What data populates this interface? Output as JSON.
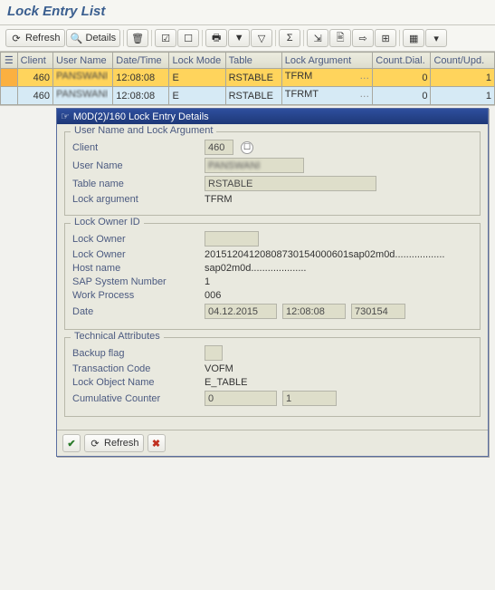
{
  "page_title": "Lock Entry List",
  "toolbar": {
    "refresh_label": "Refresh",
    "details_label": "Details"
  },
  "grid": {
    "headers": {
      "client": "Client",
      "user": "User Name",
      "datetime": "Date/Time",
      "mode": "Lock Mode",
      "table": "Table",
      "arg": "Lock Argument",
      "dial": "Count.Dial.",
      "upd": "Count/Upd."
    },
    "rows": [
      {
        "client": "460",
        "user": "PANSWANI",
        "datetime": "12:08:08",
        "mode": "E",
        "table": "RSTABLE",
        "arg": "TFRM",
        "dial": "0",
        "upd": "1"
      },
      {
        "client": "460",
        "user": "PANSWANI",
        "datetime": "12:08:08",
        "mode": "E",
        "table": "RSTABLE",
        "arg": "TFRMT",
        "dial": "0",
        "upd": "1"
      }
    ]
  },
  "dialog": {
    "title": "M0D(2)/160 Lock Entry Details",
    "g1": {
      "legend": "User Name and Lock Argument",
      "client_label": "Client",
      "client_value": "460",
      "user_label": "User Name",
      "user_value": "PANSWANI",
      "table_label": "Table name",
      "table_value": "RSTABLE",
      "lockarg_label": "Lock argument",
      "lockarg_value": "TFRM"
    },
    "g2": {
      "legend": "Lock Owner ID",
      "owner1_label": "Lock Owner",
      "owner1_value": "",
      "owner2_label": "Lock Owner",
      "owner2_value": "20151204120808730154000601sap02m0d..................",
      "host_label": "Host name",
      "host_value": "sap02m0d....................",
      "sysnr_label": "SAP System Number",
      "sysnr_value": "1",
      "wp_label": "Work Process",
      "wp_value": "006",
      "date_label": "Date",
      "date_value": "04.12.2015",
      "time_value": "12:08:08",
      "seq_value": "730154"
    },
    "g3": {
      "legend": "Technical Attributes",
      "backup_label": "Backup flag",
      "backup_value": "",
      "tcode_label": "Transaction Code",
      "tcode_value": "VOFM",
      "lockobj_label": "Lock Object Name",
      "lockobj_value": "E_TABLE",
      "cum_label": "Cumulative Counter",
      "cum_value1": "0",
      "cum_value2": "1"
    },
    "footer": {
      "refresh_label": "Refresh"
    }
  }
}
